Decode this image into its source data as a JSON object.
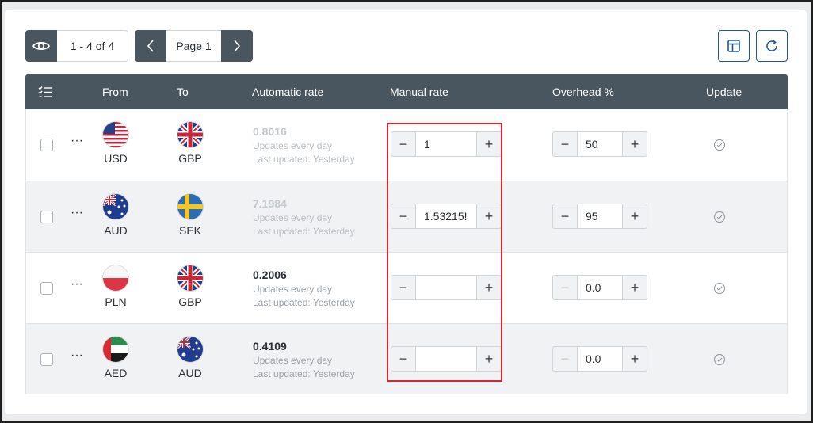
{
  "toolbar": {
    "eye_icon": "eye-icon",
    "count_text": "1 - 4 of 4",
    "page_label": "Page 1",
    "prev_icon": "chevron-left-icon",
    "next_icon": "chevron-right-icon",
    "layout_icon": "layout-icon",
    "refresh_icon": "refresh-icon"
  },
  "table": {
    "headers": {
      "select": "checklist-icon",
      "from": "From",
      "to": "To",
      "automatic_rate": "Automatic rate",
      "manual_rate": "Manual rate",
      "overhead": "Overhead %",
      "update": "Update"
    },
    "rows": [
      {
        "from": "USD",
        "to": "GBP",
        "auto_rate": "0.8016",
        "frequency": "Updates every day",
        "last_updated": "Last updated: Yesterday",
        "manual_rate": "1",
        "overhead": "50"
      },
      {
        "from": "AUD",
        "to": "SEK",
        "auto_rate": "7.1984",
        "frequency": "Updates every day",
        "last_updated": "Last updated: Yesterday",
        "manual_rate": "1.53215!",
        "overhead": "95"
      },
      {
        "from": "PLN",
        "to": "GBP",
        "auto_rate": "0.2006",
        "frequency": "Updates every day",
        "last_updated": "Last updated: Yesterday",
        "manual_rate": "",
        "overhead": "0.0"
      },
      {
        "from": "AED",
        "to": "AUD",
        "auto_rate": "0.4109",
        "frequency": "Updates every day",
        "last_updated": "Last updated: Yesterday",
        "manual_rate": "",
        "overhead": "0.0"
      }
    ]
  },
  "colors": {
    "header_bg": "#49565f",
    "accent": "#1f5a8f",
    "highlight": "#d9262e",
    "alt_row": "#f1f2f3"
  }
}
